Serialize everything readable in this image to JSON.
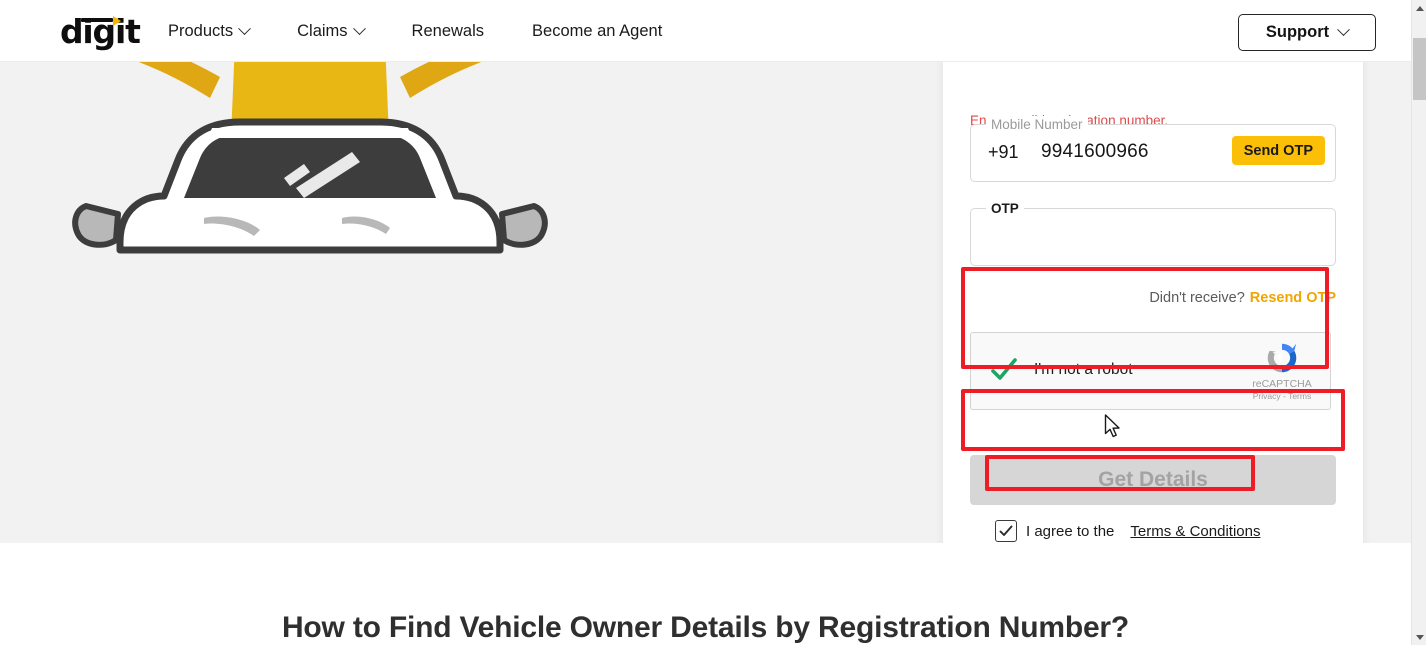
{
  "header": {
    "logo_text": "digit",
    "nav": [
      {
        "label": "Products",
        "has_chevron": true,
        "icon": "chevron-down-icon"
      },
      {
        "label": "Claims",
        "has_chevron": true,
        "icon": "chevron-down-icon"
      },
      {
        "label": "Renewals",
        "has_chevron": false,
        "icon": ""
      },
      {
        "label": "Become an Agent",
        "has_chevron": false,
        "icon": ""
      }
    ],
    "support_label": "Support",
    "support_icon": "chevron-down-icon"
  },
  "hero": {
    "illustration_alt": "person-in-yellow-sweater-behind-car"
  },
  "form": {
    "error_message": "Enter a valid registration number.",
    "mobile": {
      "label": "Mobile Number",
      "country_code": "+91",
      "value": "9941600966",
      "placeholder": "Mobile Number",
      "send_otp_label": "Send OTP"
    },
    "otp": {
      "label": "OTP",
      "value": "",
      "placeholder": "",
      "didnt_receive_text": "Didn't receive?",
      "resend_label": "Resend OTP"
    },
    "recaptcha": {
      "label": "I'm not a robot",
      "checked": true,
      "check_icon": "green-check-icon",
      "brand_icon": "recaptcha-logo-icon",
      "brand_name": "reCAPTCHA",
      "privacy_label": "Privacy",
      "separator": "-",
      "terms_label": "Terms"
    },
    "submit": {
      "label": "Get Details",
      "enabled": false
    },
    "terms": {
      "checked": true,
      "check_icon": "check-icon",
      "text": "I agree to the",
      "link_label": "Terms & Conditions"
    },
    "highlight_color": "#ee1c24"
  },
  "lower": {
    "heading": "How to Find Vehicle Owner Details by Registration Number?"
  },
  "browser": {
    "scrollbar_up_icon": "triangle-up-icon",
    "scrollbar_down_icon": "triangle-down-icon"
  },
  "colors": {
    "brand_yellow": "#fcbf07",
    "resend_orange": "#f0a500",
    "highlight_red": "#ee1c24",
    "hero_grey": "#f2f2f2",
    "disabled_grey": "#d6d6d6"
  }
}
